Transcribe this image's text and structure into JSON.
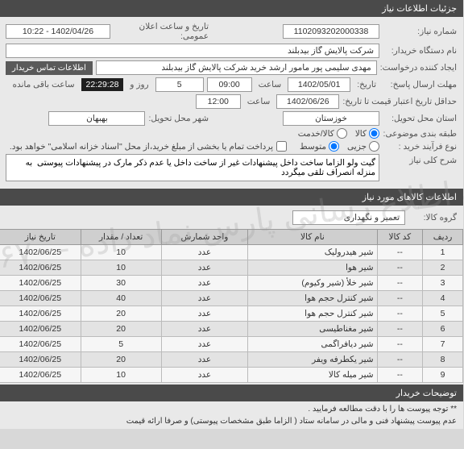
{
  "watermark": "سامانه اطلاع رسانی پارس نماد داده - ۸۸۳۴۹۶۷۰",
  "header": {
    "title": "جزئیات اطلاعات نیاز"
  },
  "form": {
    "need_no_label": "شماره نیاز:",
    "need_no": "1102093202000338",
    "announce_label": "تاریخ و ساعت اعلان عمومی:",
    "announce": "1402/04/26 - 10:22",
    "buyer_label": "نام دستگاه خریدار:",
    "buyer": "شرکت پالایش گاز بیدبلند",
    "requester_label": "ایجاد کننده درخواست:",
    "requester": "مهدی سلیمی پور مامور ارشد خرید شرکت پالایش گاز بیدبلند",
    "contact_button": "اطلاعات تماس خریدار",
    "reply_deadline_label": "مهلت ارسال پاسخ:",
    "reply_deadline_date": "1402/05/01",
    "reply_deadline_hour": "09:00",
    "reply_days": "5",
    "hour_label": "ساعت",
    "days_label": "روز و",
    "remaining_label": "ساعت باقی مانده",
    "countdown": "22:29:28",
    "valid_label": "حداقل تاریخ اعتبار قیمت تا تاریخ:",
    "valid_date": "1402/06/26",
    "valid_hour": "12:00",
    "province_label": "استان محل تحویل:",
    "province": "خوزستان",
    "city_label": "شهر محل تحویل:",
    "city": "بهبهان",
    "cat_label": "طبقه بندی موضوعی:",
    "cat_goods": "کالا",
    "cat_service": "کالا/خدمت",
    "buy_type_label": "نوع فرآیند خرید :",
    "buy_small": "جزیی",
    "buy_medium": "متوسط",
    "pay_note": "پرداخت تمام یا بخشی از مبلغ خرید،از محل \"اسناد خزانه اسلامی\" خواهد بود.",
    "desc_label": "شرح کلی نیاز",
    "desc_text": "گیت ولو الزاما ساخت داخل پیشنهادات غیر از ساخت داخل یا عدم ذکر مارک در پیشنهادات پیوستی  به منزله انصراف تلقی میگردد"
  },
  "goods_header": "اطلاعات کالاهای مورد نیاز",
  "group_label": "گروه کالا:",
  "group_value": "تعمیر و نگهداری",
  "table": {
    "headers": [
      "ردیف",
      "کد کالا",
      "نام کالا",
      "واحد شمارش",
      "تعداد / مقدار",
      "تاریخ نیاز"
    ],
    "rows": [
      [
        "1",
        "--",
        "شیر هیدرولیک",
        "عدد",
        "10",
        "1402/06/25"
      ],
      [
        "2",
        "--",
        "شیر هوا",
        "عدد",
        "10",
        "1402/06/25"
      ],
      [
        "3",
        "--",
        "شیر خلأ (شیر وکیوم)",
        "عدد",
        "30",
        "1402/06/25"
      ],
      [
        "4",
        "--",
        "شیر کنترل حجم هوا",
        "عدد",
        "40",
        "1402/06/25"
      ],
      [
        "5",
        "--",
        "شیر کنترل حجم هوا",
        "عدد",
        "20",
        "1402/06/25"
      ],
      [
        "6",
        "--",
        "شیر مغناطیسی",
        "عدد",
        "20",
        "1402/06/25"
      ],
      [
        "7",
        "--",
        "شیر دیافراگمی",
        "عدد",
        "5",
        "1402/06/25"
      ],
      [
        "8",
        "--",
        "شیر یکطرفه ویفر",
        "عدد",
        "20",
        "1402/06/25"
      ],
      [
        "9",
        "--",
        "شیر میله کالا",
        "عدد",
        "10",
        "1402/06/25"
      ]
    ]
  },
  "footer_header": "توضیحات خریدار",
  "footer_note1": "** توجه پیوست ها  را با دقت مطالعه فرمایید .",
  "footer_note2": "عدم پیوست پیشنهاد فنی و مالی در سامانه ستاد ( الزاما طبق مشخصات پیوستی)  و صرفا ارائه قیمت"
}
